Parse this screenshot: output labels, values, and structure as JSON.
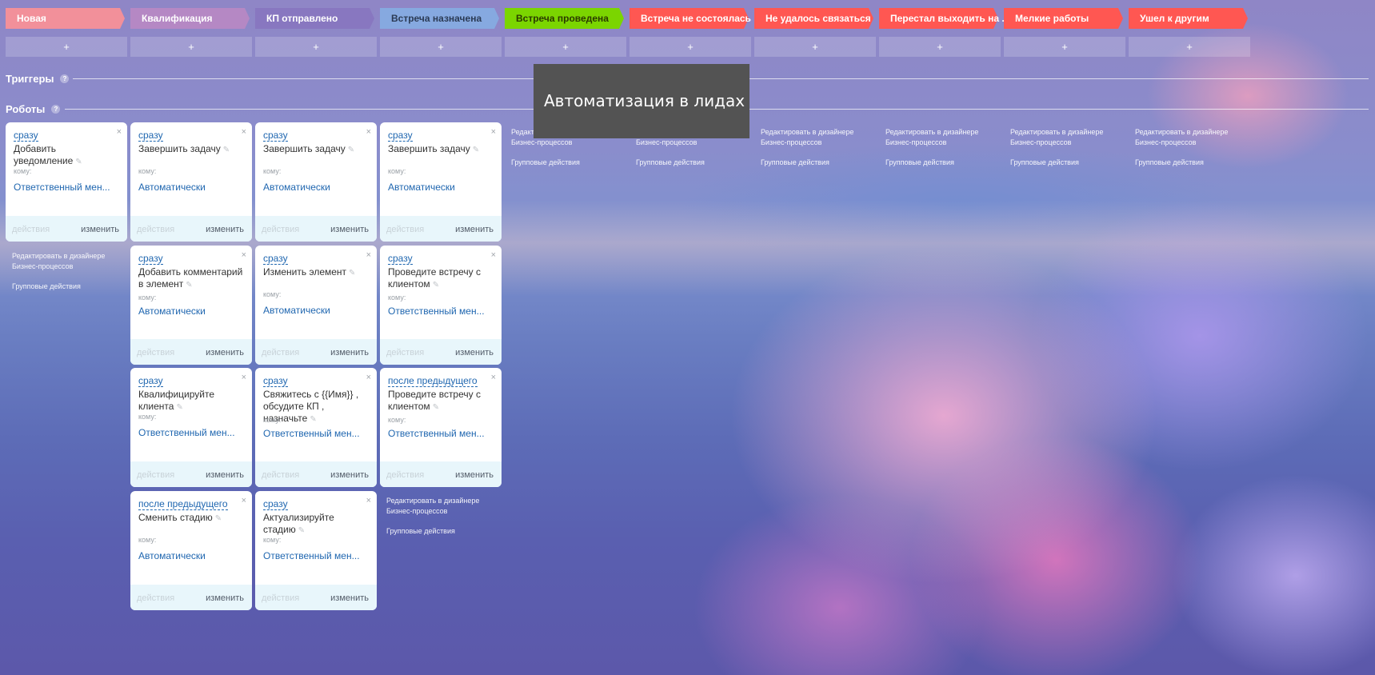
{
  "stages": [
    {
      "label": "Новая",
      "color": "#f2909a",
      "text_color": "#ffffff"
    },
    {
      "label": "Квалификация",
      "color": "#b588c4",
      "text_color": "#ffffff"
    },
    {
      "label": "КП отправлено",
      "color": "#8877c0",
      "text_color": "#ffffff"
    },
    {
      "label": "Встреча назначена",
      "color": "#86a9e0",
      "text_color": "#2b3b55"
    },
    {
      "label": "Встреча проведена",
      "color": "#7bd500",
      "text_color": "#2b3b00"
    },
    {
      "label": "Встреча не состоялась",
      "color": "#ff5752",
      "text_color": "#ffffff"
    },
    {
      "label": "Не удалось связаться",
      "color": "#ff5752",
      "text_color": "#ffffff"
    },
    {
      "label": "Перестал выходить на ...",
      "color": "#ff5752",
      "text_color": "#ffffff"
    },
    {
      "label": "Мелкие работы",
      "color": "#ff5752",
      "text_color": "#ffffff"
    },
    {
      "label": "Ушел к другим",
      "color": "#ff5752",
      "text_color": "#ffffff"
    }
  ],
  "add_label": "+",
  "triggers": {
    "title": "Триггеры",
    "help": "?"
  },
  "robots": {
    "title": "Роботы",
    "help": "?"
  },
  "card_labels": {
    "to": "кому:",
    "actions": "действия",
    "change": "изменить",
    "close": "×",
    "pen": "✎"
  },
  "columns": [
    {
      "cards": [
        {
          "when": "сразу",
          "title": "Добавить уведомление",
          "who": "Ответственный мен..."
        }
      ]
    },
    {
      "cards": [
        {
          "when": "сразу",
          "title": "Завершить задачу",
          "who": "Автоматически"
        },
        {
          "when": "сразу",
          "title": "Добавить комментарий в элемент",
          "who": "Автоматически"
        },
        {
          "when": "сразу",
          "title": "Квалифицируйте клиента",
          "who": "Ответственный мен..."
        },
        {
          "when": "после предыдущего",
          "title": "Сменить стадию",
          "who": "Автоматически"
        }
      ]
    },
    {
      "cards": [
        {
          "when": "сразу",
          "title": "Завершить задачу",
          "who": "Автоматически"
        },
        {
          "when": "сразу",
          "title": "Изменить элемент",
          "who": "Автоматически"
        },
        {
          "when": "сразу",
          "title": "Свяжитесь с {{Имя}} , обсудите КП , назначьте",
          "who": "Ответственный мен..."
        },
        {
          "when": "сразу",
          "title": "Актуализируйте стадию",
          "who": "Ответственный мен..."
        }
      ]
    },
    {
      "cards": [
        {
          "when": "сразу",
          "title": "Завершить задачу",
          "who": "Автоматически"
        },
        {
          "when": "сразу",
          "title": "Проведите встречу с клиентом",
          "who": "Ответственный мен..."
        },
        {
          "when": "после предыдущего",
          "title": "Проведите встречу с клиентом",
          "who": "Ответственный мен..."
        }
      ]
    }
  ],
  "bp_link": {
    "line1": "Редактировать в дизайнере",
    "line2": "Бизнес-процессов",
    "group": "Групповые действия"
  },
  "tooltip": "Автоматизация в лидах"
}
